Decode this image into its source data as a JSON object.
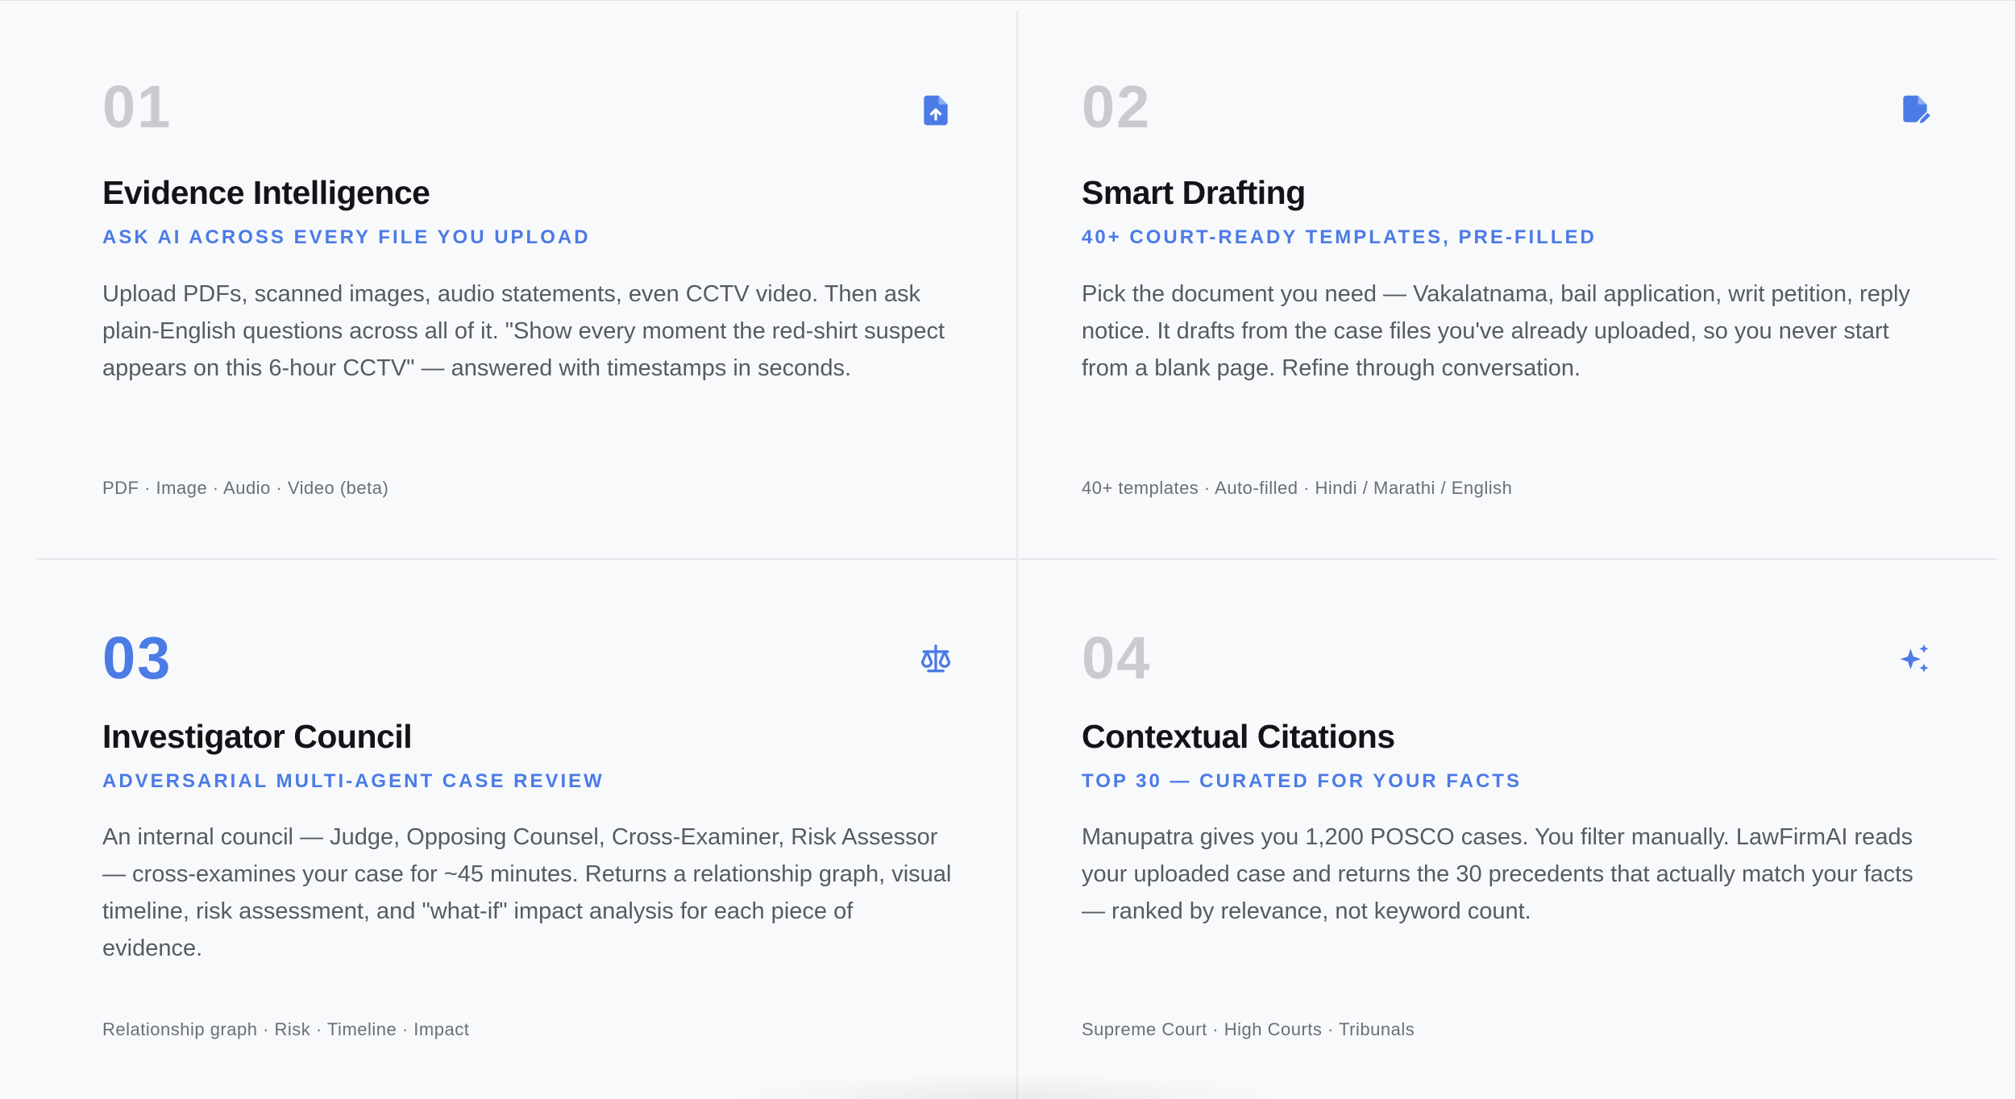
{
  "features": [
    {
      "number": "01",
      "icon": "file-upload-icon",
      "title": "Evidence Intelligence",
      "subtitle": "ASK AI ACROSS EVERY FILE YOU UPLOAD",
      "body": "Upload PDFs, scanned images, audio statements, even CCTV video. Then ask plain-English questions across all of it. \"Show every moment the red-shirt suspect appears on this 6-hour CCTV\" — answered with timestamps in seconds.",
      "tags": "PDF · Image · Audio · Video (beta)"
    },
    {
      "number": "02",
      "icon": "file-edit-icon",
      "title": "Smart Drafting",
      "subtitle": "40+ COURT-READY TEMPLATES, PRE-FILLED",
      "body": "Pick the document you need — Vakalatnama, bail application, writ petition, reply notice. It drafts from the case files you've already uploaded, so you never start from a blank page. Refine through conversation.",
      "tags": "40+ templates · Auto-filled · Hindi / Marathi / English"
    },
    {
      "number": "03",
      "icon": "scales-icon",
      "title": "Investigator Council",
      "subtitle": "ADVERSARIAL MULTI-AGENT CASE REVIEW",
      "body": "An internal council — Judge, Opposing Counsel, Cross-Examiner, Risk Assessor — cross-examines your case for ~45 minutes. Returns a relationship graph, visual timeline, risk assessment, and \"what-if\" impact analysis for each piece of evidence.",
      "tags": "Relationship graph · Risk · Timeline · Impact"
    },
    {
      "number": "04",
      "icon": "sparkles-icon",
      "title": "Contextual Citations",
      "subtitle": "TOP 30 — CURATED FOR YOUR FACTS",
      "body": "Manupatra gives you 1,200 POSCO cases. You filter manually. LawFirmAI reads your uploaded case and returns the 30 precedents that actually match your facts — ranked by relevance, not keyword count.",
      "tags": "Supreme Court · High Courts · Tribunals"
    }
  ],
  "colors": {
    "accent": "#4b7be5",
    "number_inactive": "#c9cbd0",
    "background": "#f8f9fb",
    "title": "#121417",
    "body": "#565b63"
  }
}
